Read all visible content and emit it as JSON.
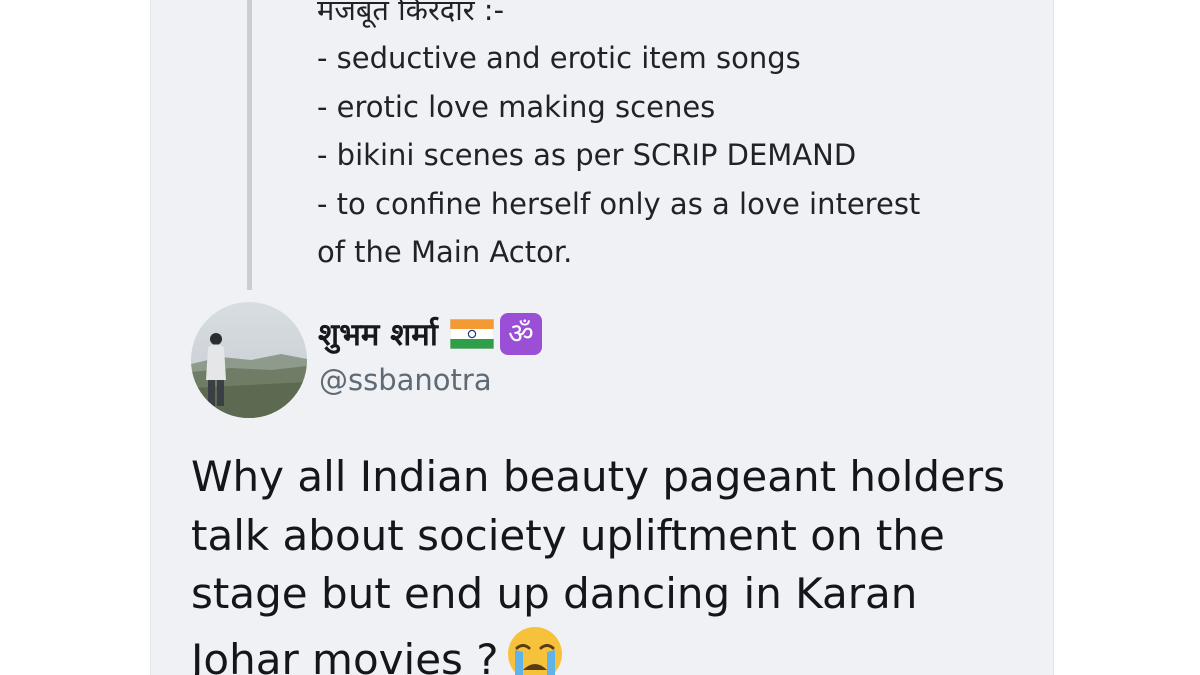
{
  "quoted_tweet": {
    "lines": [
      "मजबूत किरदार :-",
      "- seductive and erotic item songs",
      "- erotic love making scenes",
      "- bikini scenes as per SCRIP DEMAND",
      "- to confine herself only as a love interest",
      "of the Main Actor."
    ]
  },
  "author": {
    "display_name": "शुभम शर्मा",
    "handle": "@ssbanotra",
    "emoji_icons": [
      "indian-flag-icon",
      "om-symbol-icon"
    ],
    "om_glyph": "ॐ"
  },
  "tweet": {
    "lines": [
      "Why all Indian beauty pageant holders",
      "talk about society upliftment on the",
      "stage but end up dancing in Karan",
      "Johar movies ?"
    ],
    "trailing_emoji": "loudly-crying-face-icon"
  },
  "colors": {
    "background": "#eff1f4",
    "text": "#14171a",
    "secondary_text": "#5f6a74",
    "thread_line": "#c9ced4",
    "om_badge": "#9b4fd6"
  }
}
